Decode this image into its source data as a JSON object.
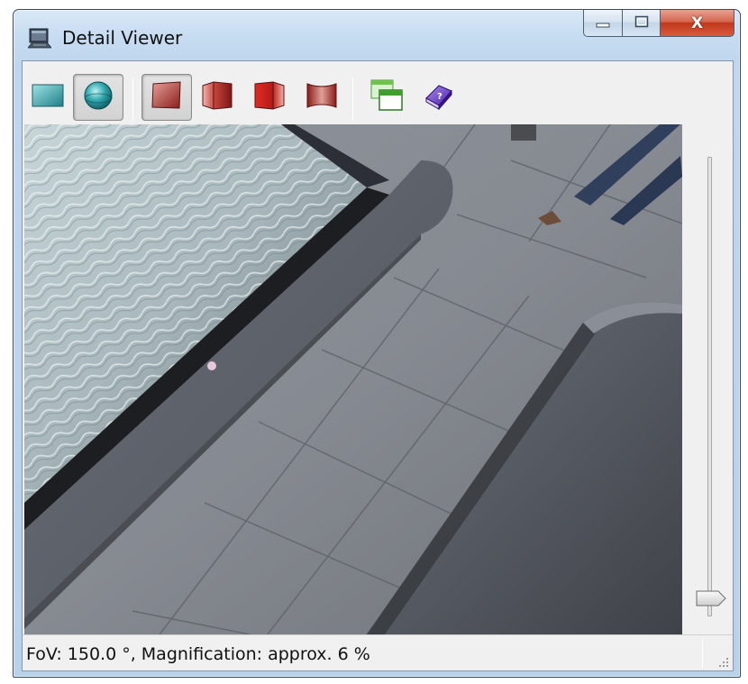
{
  "window": {
    "title": "Detail Viewer",
    "app_icon": "monitor-icon"
  },
  "caption_buttons": {
    "minimize_icon": "minimize-icon",
    "maximize_icon": "maximize-icon",
    "close_label": "X"
  },
  "toolbar": {
    "buttons": [
      {
        "name": "flat-view-button",
        "icon": "flat-rectangle-icon",
        "pressed": false
      },
      {
        "name": "sphere-view-button",
        "icon": "sphere-icon",
        "pressed": true
      },
      {
        "name": "projection-1-button",
        "icon": "red-panel-flat-icon",
        "pressed": true
      },
      {
        "name": "projection-2-button",
        "icon": "red-panel-left-icon",
        "pressed": false
      },
      {
        "name": "projection-3-button",
        "icon": "red-panel-right-icon",
        "pressed": false
      },
      {
        "name": "projection-4-button",
        "icon": "red-panel-curved-icon",
        "pressed": false
      },
      {
        "name": "windows-button",
        "icon": "windows-stack-icon",
        "pressed": false
      },
      {
        "name": "help-button",
        "icon": "help-book-icon",
        "pressed": false
      }
    ]
  },
  "viewport": {
    "image": "photo-view",
    "description_icon": "pool-edge-photo"
  },
  "slider": {
    "fraction": 0.02
  },
  "status": {
    "text": "FoV: 150.0 °, Magnification: approx. 6 %"
  },
  "colors": {
    "titlebar": "#c7dcf1",
    "close_button": "#c1381c",
    "toolbar_red": "#a42a28",
    "toolbar_teal": "#2a9aa0"
  }
}
